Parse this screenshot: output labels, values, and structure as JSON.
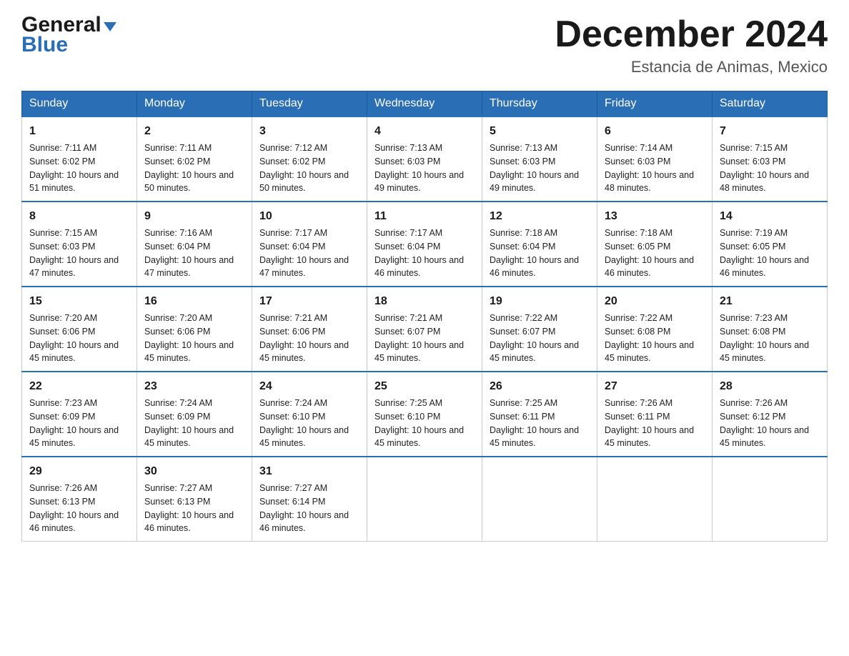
{
  "logo": {
    "general": "General",
    "triangle": "▼",
    "blue": "Blue"
  },
  "title": "December 2024",
  "location": "Estancia de Animas, Mexico",
  "days_of_week": [
    "Sunday",
    "Monday",
    "Tuesday",
    "Wednesday",
    "Thursday",
    "Friday",
    "Saturday"
  ],
  "weeks": [
    [
      {
        "day": "1",
        "sunrise": "7:11 AM",
        "sunset": "6:02 PM",
        "daylight": "10 hours and 51 minutes."
      },
      {
        "day": "2",
        "sunrise": "7:11 AM",
        "sunset": "6:02 PM",
        "daylight": "10 hours and 50 minutes."
      },
      {
        "day": "3",
        "sunrise": "7:12 AM",
        "sunset": "6:02 PM",
        "daylight": "10 hours and 50 minutes."
      },
      {
        "day": "4",
        "sunrise": "7:13 AM",
        "sunset": "6:03 PM",
        "daylight": "10 hours and 49 minutes."
      },
      {
        "day": "5",
        "sunrise": "7:13 AM",
        "sunset": "6:03 PM",
        "daylight": "10 hours and 49 minutes."
      },
      {
        "day": "6",
        "sunrise": "7:14 AM",
        "sunset": "6:03 PM",
        "daylight": "10 hours and 48 minutes."
      },
      {
        "day": "7",
        "sunrise": "7:15 AM",
        "sunset": "6:03 PM",
        "daylight": "10 hours and 48 minutes."
      }
    ],
    [
      {
        "day": "8",
        "sunrise": "7:15 AM",
        "sunset": "6:03 PM",
        "daylight": "10 hours and 47 minutes."
      },
      {
        "day": "9",
        "sunrise": "7:16 AM",
        "sunset": "6:04 PM",
        "daylight": "10 hours and 47 minutes."
      },
      {
        "day": "10",
        "sunrise": "7:17 AM",
        "sunset": "6:04 PM",
        "daylight": "10 hours and 47 minutes."
      },
      {
        "day": "11",
        "sunrise": "7:17 AM",
        "sunset": "6:04 PM",
        "daylight": "10 hours and 46 minutes."
      },
      {
        "day": "12",
        "sunrise": "7:18 AM",
        "sunset": "6:04 PM",
        "daylight": "10 hours and 46 minutes."
      },
      {
        "day": "13",
        "sunrise": "7:18 AM",
        "sunset": "6:05 PM",
        "daylight": "10 hours and 46 minutes."
      },
      {
        "day": "14",
        "sunrise": "7:19 AM",
        "sunset": "6:05 PM",
        "daylight": "10 hours and 46 minutes."
      }
    ],
    [
      {
        "day": "15",
        "sunrise": "7:20 AM",
        "sunset": "6:06 PM",
        "daylight": "10 hours and 45 minutes."
      },
      {
        "day": "16",
        "sunrise": "7:20 AM",
        "sunset": "6:06 PM",
        "daylight": "10 hours and 45 minutes."
      },
      {
        "day": "17",
        "sunrise": "7:21 AM",
        "sunset": "6:06 PM",
        "daylight": "10 hours and 45 minutes."
      },
      {
        "day": "18",
        "sunrise": "7:21 AM",
        "sunset": "6:07 PM",
        "daylight": "10 hours and 45 minutes."
      },
      {
        "day": "19",
        "sunrise": "7:22 AM",
        "sunset": "6:07 PM",
        "daylight": "10 hours and 45 minutes."
      },
      {
        "day": "20",
        "sunrise": "7:22 AM",
        "sunset": "6:08 PM",
        "daylight": "10 hours and 45 minutes."
      },
      {
        "day": "21",
        "sunrise": "7:23 AM",
        "sunset": "6:08 PM",
        "daylight": "10 hours and 45 minutes."
      }
    ],
    [
      {
        "day": "22",
        "sunrise": "7:23 AM",
        "sunset": "6:09 PM",
        "daylight": "10 hours and 45 minutes."
      },
      {
        "day": "23",
        "sunrise": "7:24 AM",
        "sunset": "6:09 PM",
        "daylight": "10 hours and 45 minutes."
      },
      {
        "day": "24",
        "sunrise": "7:24 AM",
        "sunset": "6:10 PM",
        "daylight": "10 hours and 45 minutes."
      },
      {
        "day": "25",
        "sunrise": "7:25 AM",
        "sunset": "6:10 PM",
        "daylight": "10 hours and 45 minutes."
      },
      {
        "day": "26",
        "sunrise": "7:25 AM",
        "sunset": "6:11 PM",
        "daylight": "10 hours and 45 minutes."
      },
      {
        "day": "27",
        "sunrise": "7:26 AM",
        "sunset": "6:11 PM",
        "daylight": "10 hours and 45 minutes."
      },
      {
        "day": "28",
        "sunrise": "7:26 AM",
        "sunset": "6:12 PM",
        "daylight": "10 hours and 45 minutes."
      }
    ],
    [
      {
        "day": "29",
        "sunrise": "7:26 AM",
        "sunset": "6:13 PM",
        "daylight": "10 hours and 46 minutes."
      },
      {
        "day": "30",
        "sunrise": "7:27 AM",
        "sunset": "6:13 PM",
        "daylight": "10 hours and 46 minutes."
      },
      {
        "day": "31",
        "sunrise": "7:27 AM",
        "sunset": "6:14 PM",
        "daylight": "10 hours and 46 minutes."
      },
      null,
      null,
      null,
      null
    ]
  ]
}
